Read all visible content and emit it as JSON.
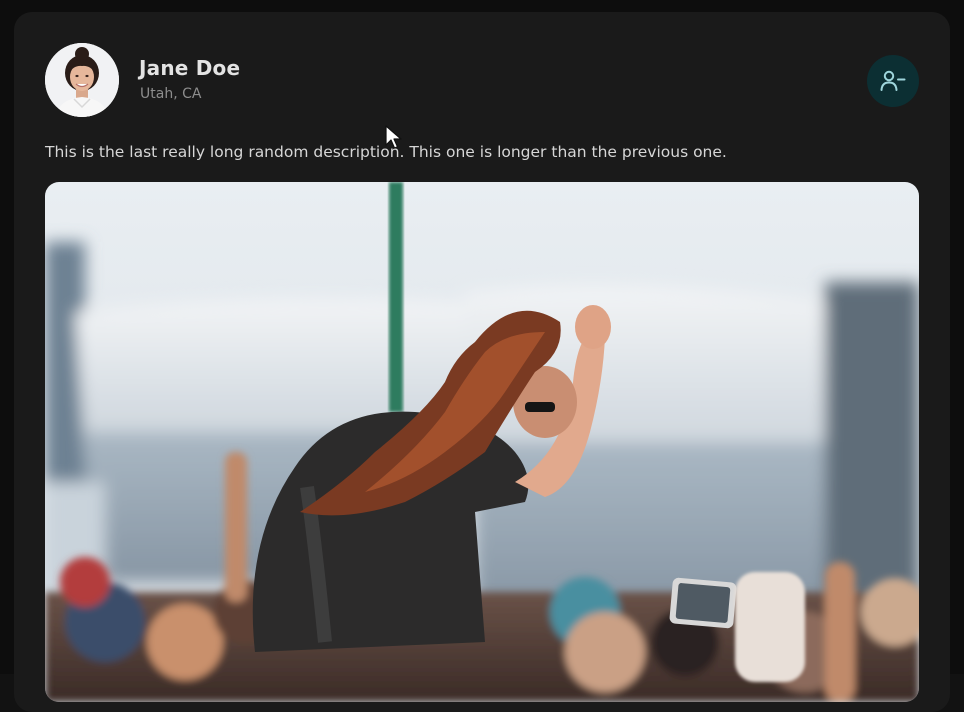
{
  "post": {
    "author": {
      "name": "Jane Doe",
      "location": "Utah, CA",
      "avatar_icon": "user-avatar-photo"
    },
    "description": "This is the last really long random description. This one is longer than the previous one.",
    "action_icon": "remove-friend-icon",
    "image_subject": "concert-crowd-photo"
  },
  "colors": {
    "card_bg": "#1a1a1a",
    "page_bg": "#0d0d0d",
    "friend_button_bg": "#0c2f33",
    "friend_icon": "#9fd6dc",
    "name_text": "#e3e3e3",
    "location_text": "#8d8d8d"
  }
}
